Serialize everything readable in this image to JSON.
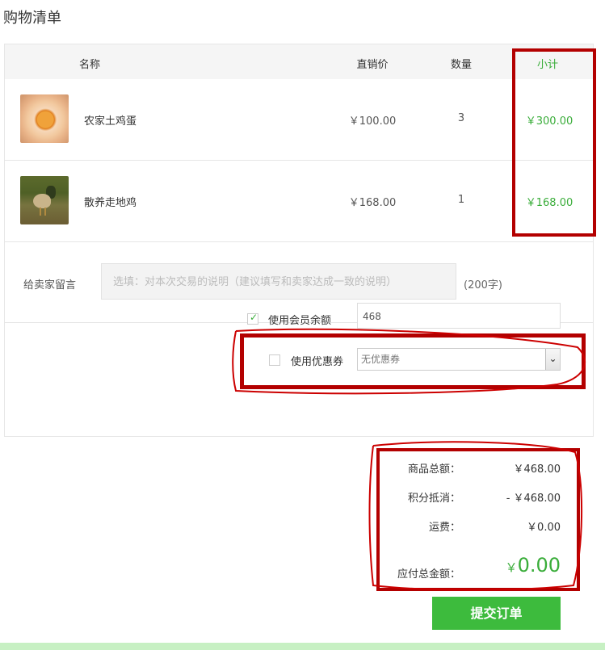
{
  "page": {
    "title": "购物清单"
  },
  "table": {
    "headers": {
      "name": "名称",
      "price": "直销价",
      "quantity": "数量",
      "subtotal": "小计"
    },
    "rows": [
      {
        "name": "农家土鸡蛋",
        "price": "￥100.00",
        "quantity": "3",
        "subtotal": "￥300.00",
        "thumb": "egg-image"
      },
      {
        "name": "散养走地鸡",
        "price": "￥168.00",
        "quantity": "1",
        "subtotal": "￥168.00",
        "thumb": "chicken-image"
      }
    ]
  },
  "message": {
    "label": "给卖家留言",
    "placeholder": "选填：对本次交易的说明（建议填写和卖家达成一致的说明）",
    "limit": "(200字)"
  },
  "balance": {
    "checked": true,
    "label": "使用会员余额",
    "value": "468"
  },
  "coupon": {
    "checked": false,
    "label": "使用优惠券",
    "selected": "无优惠券"
  },
  "summary": {
    "goods_total_label": "商品总额：",
    "goods_total": "￥468.00",
    "points_label": "积分抵消：",
    "points": "- ￥468.00",
    "shipping_label": "运费：",
    "shipping": "￥0.00",
    "payable_label": "应付总金额：",
    "payable_currency": "￥",
    "payable": "0.00"
  },
  "submit": {
    "label": "提交订单"
  },
  "colors": {
    "accent": "#3aad3a",
    "annotation": "#b30000",
    "button": "#3dbb3d"
  }
}
